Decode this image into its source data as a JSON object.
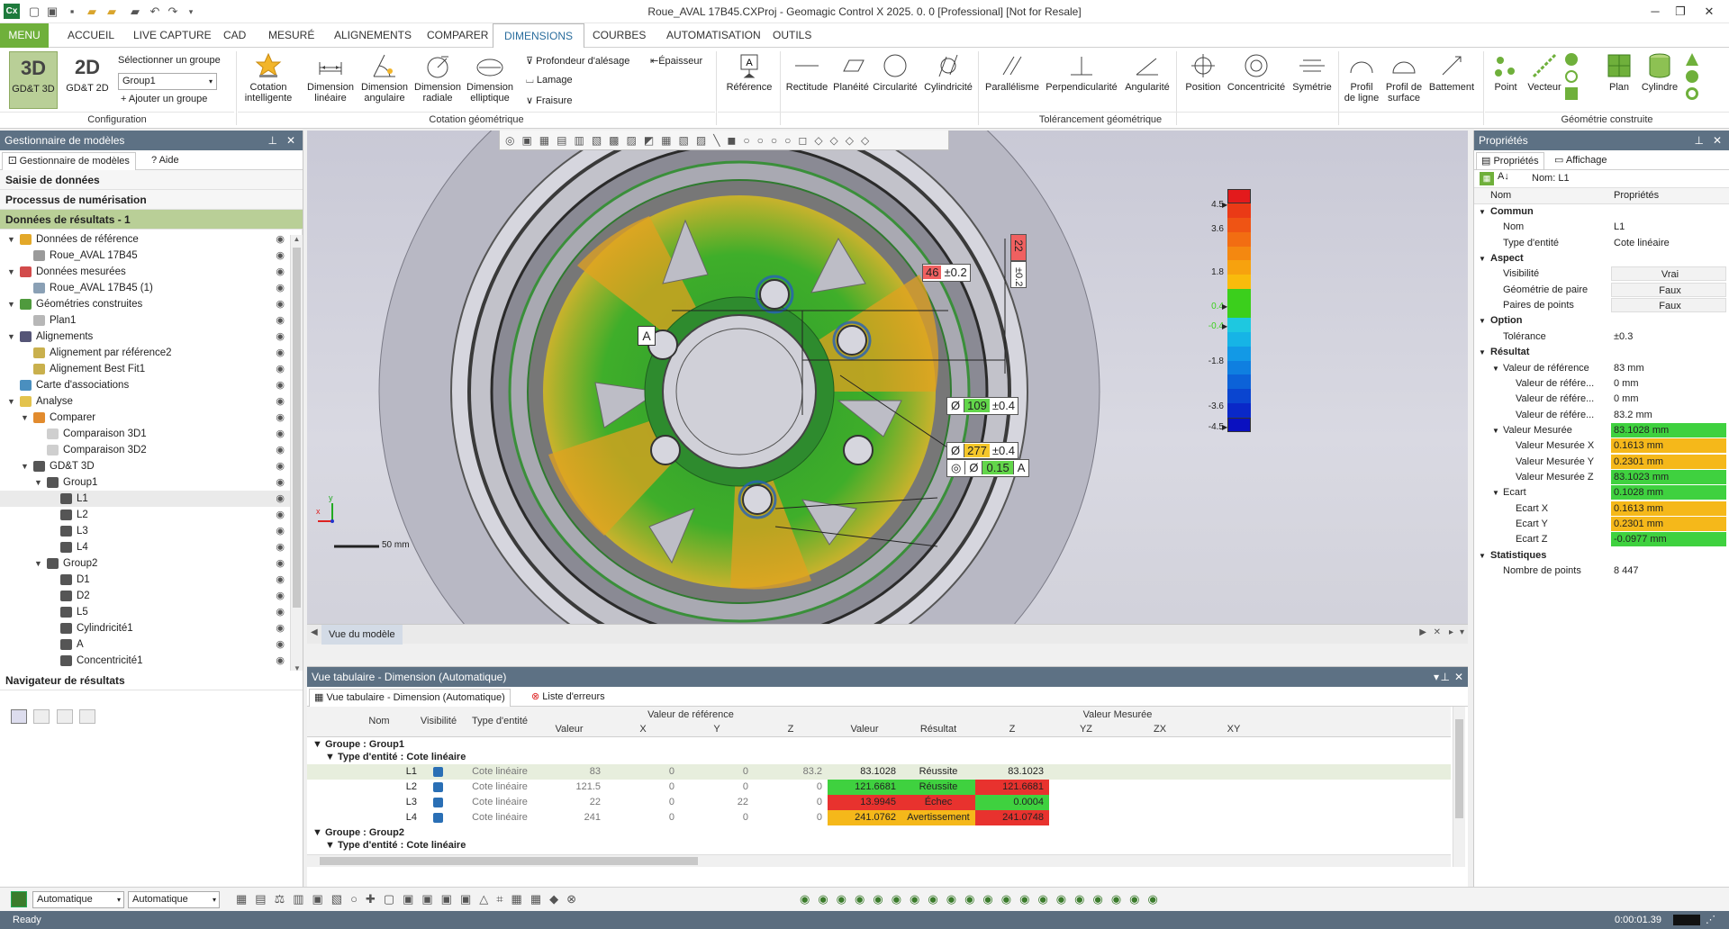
{
  "titlebar": {
    "app_icon": "Cx",
    "title": "Roue_AVAL  17B45.CXProj - Geomagic Control X 2025. 0. 0 [Professional] [Not for Resale]"
  },
  "menubar": {
    "menu": "MENU",
    "tabs": [
      "ACCUEIL",
      "LIVE CAPTURE",
      "CAD",
      "MESURÉ",
      "ALIGNEMENTS",
      "COMPARER",
      "DIMENSIONS",
      "COURBES",
      "AUTOMATISATION",
      "OUTILS"
    ],
    "active": "DIMENSIONS"
  },
  "ribbon": {
    "config": {
      "btn3d_big": "3D",
      "btn3d_label": "GD&T 3D",
      "btn2d_big": "2D",
      "btn2d_label": "GD&T 2D",
      "select_label": "Sélectionner un groupe",
      "group_value": "Group1",
      "add_group": "Ajouter un groupe",
      "group_title": "Configuration"
    },
    "cotation": {
      "items": [
        {
          "l1": "Cotation",
          "l2": "intelligente"
        },
        {
          "l1": "Dimension",
          "l2": "linéaire"
        },
        {
          "l1": "Dimension",
          "l2": "angulaire"
        },
        {
          "l1": "Dimension",
          "l2": "radiale"
        },
        {
          "l1": "Dimension",
          "l2": "elliptique"
        }
      ],
      "small": [
        "Profondeur d'alésage",
        "Lamage",
        "Fraisure"
      ],
      "epaisseur": "Épaisseur",
      "group_title": "Cotation géométrique"
    },
    "tolerance": {
      "items": [
        "Référence",
        "Rectitude",
        "Planéité",
        "Circularité",
        "Cylindricité",
        "Parallélisme",
        "Perpendicularité",
        "Angularité",
        "Position",
        "Concentricité",
        "Symétrie"
      ],
      "profil_ligne": [
        "Profil",
        "de ligne"
      ],
      "profil_surface": [
        "Profil de",
        "surface"
      ],
      "battement": "Battement",
      "group_title": "Tolérancement géométrique"
    },
    "geometrie": {
      "items": [
        "Point",
        "Vecteur",
        "Plan",
        "Cylindre"
      ],
      "group_title": "Géométrie construite"
    }
  },
  "left": {
    "header": "Gestionnaire de modèles",
    "tabs": [
      "Gestionnaire de modèles",
      "Aide"
    ],
    "sections": [
      "Saisie de données",
      "Processus de numérisation",
      "Données de résultats - 1"
    ],
    "tree": [
      {
        "label": "Données de référence",
        "lvl": 0,
        "exp": "▼",
        "icon": "#e3a829"
      },
      {
        "label": "Roue_AVAL  17B45",
        "lvl": 1,
        "exp": "",
        "icon": "#9a9a9a"
      },
      {
        "label": "Données mesurées",
        "lvl": 0,
        "exp": "▼",
        "icon": "#d24b4b"
      },
      {
        "label": "Roue_AVAL  17B45 (1)",
        "lvl": 1,
        "exp": "",
        "icon": "#8aa0b5"
      },
      {
        "label": "Géométries construites",
        "lvl": 0,
        "exp": "▼",
        "icon": "#4f9a3d"
      },
      {
        "label": "Plan1",
        "lvl": 1,
        "exp": "",
        "icon": "#b7b7b7"
      },
      {
        "label": "Alignements",
        "lvl": 0,
        "exp": "▼",
        "icon": "#557"
      },
      {
        "label": "Alignement par référence2",
        "lvl": 1,
        "exp": "",
        "icon": "#c9b04d"
      },
      {
        "label": "Alignement Best Fit1",
        "lvl": 1,
        "exp": "",
        "icon": "#c9b04d"
      },
      {
        "label": "Carte d'associations",
        "lvl": 0,
        "exp": "",
        "icon": "#4a8fbf"
      },
      {
        "label": "Analyse",
        "lvl": 0,
        "exp": "▼",
        "icon": "#e3c34d"
      },
      {
        "label": "Comparer",
        "lvl": 1,
        "exp": "▼",
        "icon": "#e28b2e"
      },
      {
        "label": "Comparaison 3D1",
        "lvl": 2,
        "exp": "",
        "icon": "#cfcfcf"
      },
      {
        "label": "Comparaison 3D2",
        "lvl": 2,
        "exp": "",
        "icon": "#cfcfcf"
      },
      {
        "label": "GD&T 3D",
        "lvl": 1,
        "exp": "▼",
        "icon": "#555"
      },
      {
        "label": "Group1",
        "lvl": 2,
        "exp": "▼",
        "icon": "#555"
      },
      {
        "label": "L1",
        "lvl": 3,
        "exp": "",
        "icon": "#555",
        "sel": true
      },
      {
        "label": "L2",
        "lvl": 3,
        "exp": "",
        "icon": "#555"
      },
      {
        "label": "L3",
        "lvl": 3,
        "exp": "",
        "icon": "#555"
      },
      {
        "label": "L4",
        "lvl": 3,
        "exp": "",
        "icon": "#555"
      },
      {
        "label": "Group2",
        "lvl": 2,
        "exp": "▼",
        "icon": "#555"
      },
      {
        "label": "D1",
        "lvl": 3,
        "exp": "",
        "icon": "#555"
      },
      {
        "label": "D2",
        "lvl": 3,
        "exp": "",
        "icon": "#555"
      },
      {
        "label": "L5",
        "lvl": 3,
        "exp": "",
        "icon": "#555"
      },
      {
        "label": "Cylindricité1",
        "lvl": 3,
        "exp": "",
        "icon": "#555"
      },
      {
        "label": "A",
        "lvl": 3,
        "exp": "",
        "icon": "#555"
      },
      {
        "label": "Concentricité1",
        "lvl": 3,
        "exp": "",
        "icon": "#555"
      }
    ],
    "nav": "Navigateur de résultats"
  },
  "viewport": {
    "scale": "50 mm",
    "tab": "Vue du modèle",
    "callouts": {
      "c46": "46",
      "c46tol": "±0.2",
      "c22": "22",
      "c22tol": "±0.2",
      "c109": "109",
      "c109tol": "±0.4",
      "c277": "277",
      "c277tol": "±0.4",
      "c015": "0.15",
      "datum": "A",
      "diam": "Ø",
      "a": "A"
    },
    "colorbar": [
      "4.5",
      "3.6",
      "1.8",
      "0.4",
      "-0.4",
      "-1.8",
      "-3.6",
      "-4.5"
    ]
  },
  "right": {
    "header": "Propriétés",
    "tabs": [
      "Propriétés",
      "Affichage"
    ],
    "nom": "Nom: L1",
    "cols": [
      "Nom",
      "Propriétés"
    ],
    "rows": [
      {
        "k": "Commun",
        "v": "",
        "t": "h"
      },
      {
        "k": "Nom",
        "v": "L1",
        "t": "1"
      },
      {
        "k": "Type d'entité",
        "v": "Cote linéaire",
        "t": "1"
      },
      {
        "k": "Aspect",
        "v": "",
        "t": "h"
      },
      {
        "k": "Visibilité",
        "v": "Vrai",
        "t": "1",
        "c": "box"
      },
      {
        "k": "Géométrie de paire",
        "v": "Faux",
        "t": "1",
        "c": "box"
      },
      {
        "k": "Paires de points",
        "v": "Faux",
        "t": "1",
        "c": "box"
      },
      {
        "k": "Option",
        "v": "",
        "t": "h"
      },
      {
        "k": "Tolérance",
        "v": "±0.3",
        "t": "1"
      },
      {
        "k": "Résultat",
        "v": "",
        "t": "h"
      },
      {
        "k": "Valeur de référence",
        "v": "83 mm",
        "t": "s"
      },
      {
        "k": "Valeur de référe...",
        "v": "0 mm",
        "t": "2"
      },
      {
        "k": "Valeur de référe...",
        "v": "0 mm",
        "t": "2"
      },
      {
        "k": "Valeur de référe...",
        "v": "83.2 mm",
        "t": "2"
      },
      {
        "k": "Valeur Mesurée",
        "v": "83.1028 mm",
        "t": "s",
        "c": "#3fd13f"
      },
      {
        "k": "Valeur Mesurée X",
        "v": "0.1613 mm",
        "t": "2",
        "c": "#f5b81a"
      },
      {
        "k": "Valeur Mesurée Y",
        "v": "0.2301 mm",
        "t": "2",
        "c": "#f5b81a"
      },
      {
        "k": "Valeur Mesurée Z",
        "v": "83.1023 mm",
        "t": "2",
        "c": "#3fd13f"
      },
      {
        "k": "Ecart",
        "v": "0.1028 mm",
        "t": "s",
        "c": "#3fd13f"
      },
      {
        "k": "Ecart X",
        "v": "0.1613 mm",
        "t": "2",
        "c": "#f5b81a"
      },
      {
        "k": "Ecart Y",
        "v": "0.2301 mm",
        "t": "2",
        "c": "#f5b81a"
      },
      {
        "k": "Ecart Z",
        "v": "-0.0977 mm",
        "t": "2",
        "c": "#3fd13f"
      },
      {
        "k": "Statistiques",
        "v": "",
        "t": "h"
      },
      {
        "k": "Nombre de points",
        "v": "8 447",
        "t": "1"
      }
    ]
  },
  "table": {
    "header": "Vue tabulaire - Dimension (Automatique)",
    "tabs": [
      "Vue tabulaire - Dimension (Automatique)",
      "Liste d'erreurs"
    ],
    "groups": {
      "ref": "Valeur de référence",
      "mes": "Valeur Mesurée"
    },
    "cols": [
      "Nom",
      "Visibilité",
      "Type d'entité",
      "Valeur",
      "X",
      "Y",
      "Z",
      "Valeur",
      "Résultat",
      "Z",
      "YZ",
      "ZX",
      "XY"
    ],
    "group1": "Groupe : Group1",
    "type1": "Type d'entité : Cote linéaire",
    "rows": [
      {
        "nom": "L1",
        "type": "Cote linéaire",
        "val": "83",
        "x": "0",
        "y": "0",
        "z": "83.2",
        "mval": "83.1028",
        "res": "Réussite",
        "mz": "83.1023",
        "cv": "",
        "cr": "",
        "cz": ""
      },
      {
        "nom": "L2",
        "type": "Cote linéaire",
        "val": "121.5",
        "x": "0",
        "y": "0",
        "z": "0",
        "mval": "121.6681",
        "res": "Réussite",
        "mz": "121.6681",
        "cv": "#3fd13f",
        "cr": "#3fd13f",
        "cz": "#e8322e"
      },
      {
        "nom": "L3",
        "type": "Cote linéaire",
        "val": "22",
        "x": "0",
        "y": "22",
        "z": "0",
        "mval": "13.9945",
        "res": "Échec",
        "mz": "0.0004",
        "cv": "#e8322e",
        "cr": "#e8322e",
        "cz": "#3fd13f"
      },
      {
        "nom": "L4",
        "type": "Cote linéaire",
        "val": "241",
        "x": "0",
        "y": "0",
        "z": "0",
        "mval": "241.0762",
        "res": "Avertissement",
        "mz": "241.0748",
        "cv": "#f5b81a",
        "cr": "#f5b81a",
        "cz": "#e8322e"
      }
    ],
    "group2": "Groupe : Group2",
    "type2": "Type d'entité : Cote linéaire"
  },
  "bottom": {
    "sel1": "Automatique",
    "sel2": "Automatique"
  },
  "status": {
    "left": "Ready",
    "time": "0:00:01.39"
  }
}
